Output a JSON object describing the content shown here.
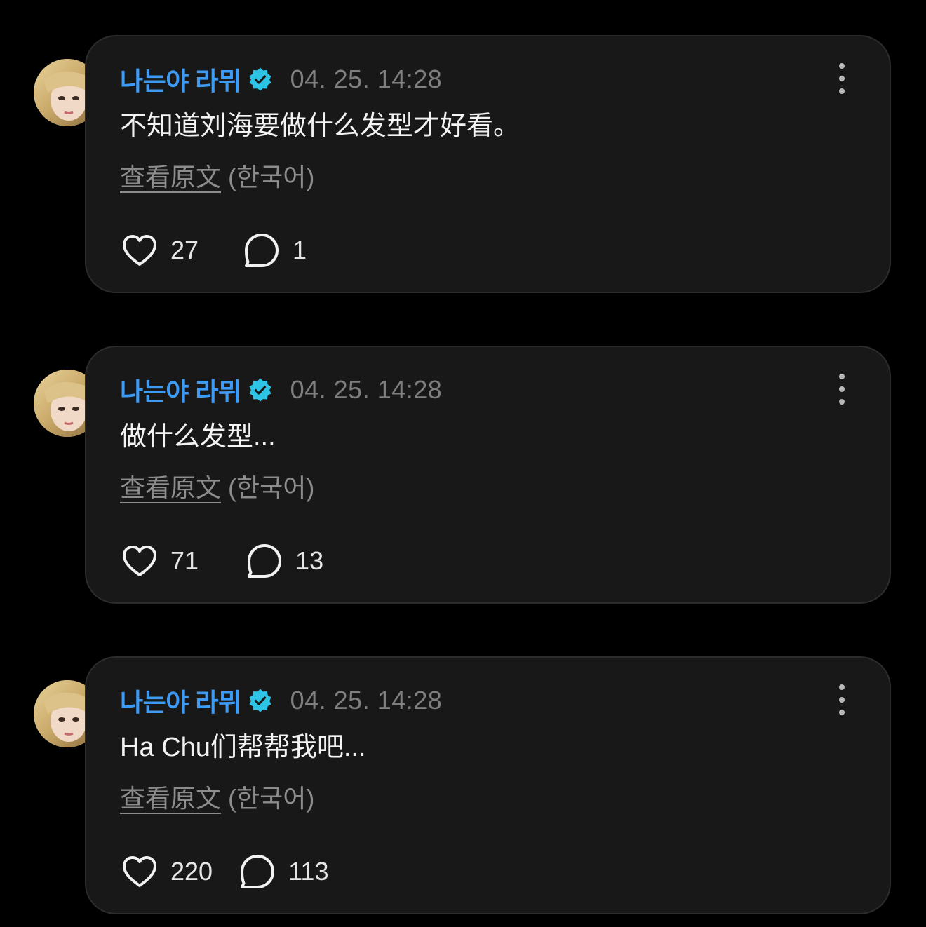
{
  "colors": {
    "background": "#000000",
    "card": "#181818",
    "author": "#3d9bf5",
    "verified_badge": "#2ec4e6",
    "timestamp": "#7f7f7f"
  },
  "icons": {
    "verified": "verified-badge-icon",
    "more": "more-vertical-icon",
    "like": "heart-icon",
    "reply": "speech-bubble-icon"
  },
  "posts": [
    {
      "author": "나는야 라뮈",
      "timestamp": "04. 25. 14:28",
      "text": "不知道刘海要做什么发型才好看。",
      "see_original": "查看原文",
      "original_language": "(한국어)",
      "likes": "27",
      "replies": "1"
    },
    {
      "author": "나는야 라뮈",
      "timestamp": "04. 25. 14:28",
      "text": "做什么发型...",
      "see_original": "查看原文",
      "original_language": "(한국어)",
      "likes": "71",
      "replies": "13"
    },
    {
      "author": "나는야 라뮈",
      "timestamp": "04. 25. 14:28",
      "text": "Ha Chu们帮帮我吧...",
      "see_original": "查看原文",
      "original_language": "(한국어)",
      "likes": "220",
      "replies": "113"
    }
  ]
}
